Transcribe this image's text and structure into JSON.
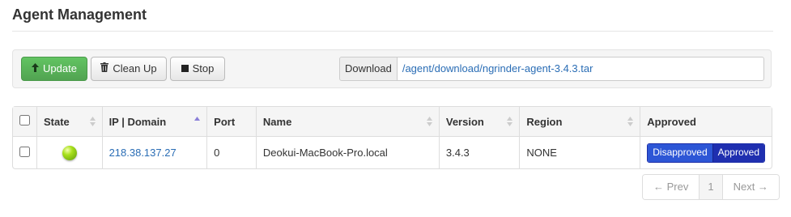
{
  "page": {
    "title": "Agent Management"
  },
  "toolbar": {
    "update_label": "Update",
    "update_icon": "arrow-up-icon",
    "cleanup_label": "Clean Up",
    "cleanup_icon": "trash-icon",
    "stop_label": "Stop",
    "stop_icon": "stop-icon",
    "download_label": "Download",
    "download_link": "/agent/download/ngrinder-agent-3.4.3.tar"
  },
  "table": {
    "columns": [
      "",
      "State",
      "IP | Domain",
      "Port",
      "Name",
      "Version",
      "Region",
      "Approved"
    ],
    "sorted_column": "IP | Domain",
    "rows": [
      {
        "selected": false,
        "state": "green",
        "ip": "218.38.137.27",
        "port": "0",
        "name": "Deokui-MacBook-Pro.local",
        "version": "3.4.3",
        "region": "NONE",
        "approve_options": [
          "Disapproved",
          "Approved"
        ]
      }
    ]
  },
  "pagination": {
    "prev": "← Prev",
    "current": "1",
    "next": "Next →"
  },
  "colors": {
    "success": "#5bb75b",
    "link": "#2a6db5",
    "approved_bg": "#1f2fb0",
    "disapproved_bg": "#2d56d6",
    "state_ok": "#8ed21a"
  }
}
